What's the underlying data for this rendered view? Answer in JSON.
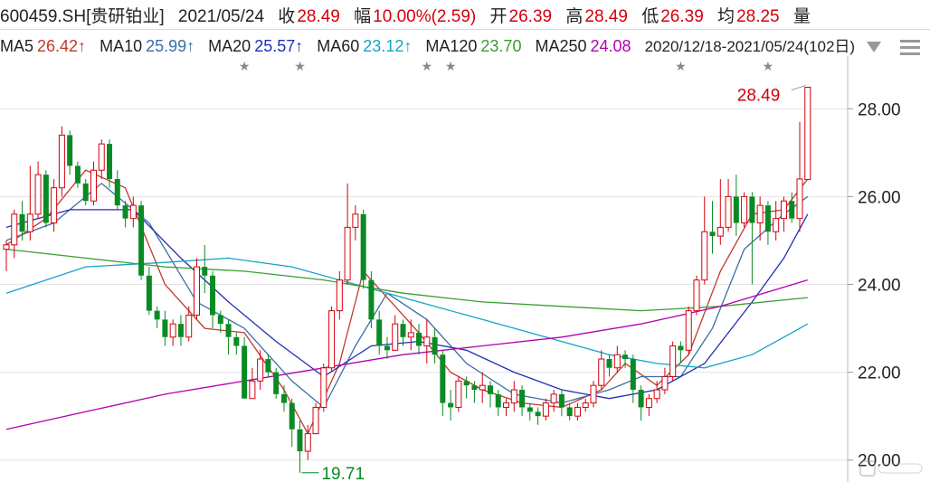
{
  "header": {
    "symbol": "600459.SH[贵研铂业]",
    "date": "2021/05/24",
    "close_label": "收",
    "close": "28.49",
    "change_label": "幅",
    "change": "10.00%(2.59)",
    "open_label": "开",
    "open": "26.39",
    "high_label": "高",
    "high": "28.49",
    "low_label": "低",
    "low": "26.39",
    "avg_label": "均",
    "avg": "28.25",
    "vol_label": "量"
  },
  "ma_bar": [
    {
      "name": "MA5",
      "value": "26.42↑",
      "color": "#c0392b"
    },
    {
      "name": "MA10",
      "value": "25.99↑",
      "color": "#3a6ea5"
    },
    {
      "name": "MA20",
      "value": "25.57↑",
      "color": "#1f2fb8"
    },
    {
      "name": "MA60",
      "value": "23.12↑",
      "color": "#14a4c4"
    },
    {
      "name": "MA120",
      "value": "23.70",
      "color": "#3a9c2f"
    },
    {
      "name": "MA250",
      "value": "24.08",
      "color": "#b100b1"
    }
  ],
  "range_text": "2020/12/18-2021/05/24(102日)",
  "chart_data": {
    "type": "candlestick",
    "ylim": [
      19.5,
      29.2
    ],
    "yticks": [
      "20.00",
      "22.00",
      "24.00",
      "26.00",
      "28.00"
    ],
    "ytick_values": [
      20,
      22,
      24,
      26,
      28
    ],
    "high_marker": {
      "label": "28.49",
      "index": 101,
      "value": 28.49
    },
    "low_marker": {
      "label": "19.71",
      "index": 37,
      "value": 19.71
    },
    "event_star_indices": [
      30,
      37,
      53,
      56,
      85,
      96
    ],
    "candles": [
      [
        24.8,
        24.9,
        24.3,
        25.0
      ],
      [
        24.9,
        25.6,
        24.6,
        25.7
      ],
      [
        25.6,
        25.2,
        25.0,
        25.9
      ],
      [
        25.2,
        25.6,
        25.0,
        26.7
      ],
      [
        25.6,
        26.5,
        25.5,
        26.8
      ],
      [
        26.5,
        25.4,
        25.3,
        26.6
      ],
      [
        25.4,
        26.2,
        25.2,
        26.4
      ],
      [
        26.2,
        27.4,
        26.0,
        27.6
      ],
      [
        27.4,
        26.7,
        26.5,
        27.5
      ],
      [
        26.7,
        26.3,
        26.2,
        26.8
      ],
      [
        26.3,
        25.9,
        25.8,
        26.4
      ],
      [
        25.9,
        26.6,
        25.8,
        26.8
      ],
      [
        26.6,
        27.2,
        26.4,
        27.3
      ],
      [
        27.2,
        26.4,
        26.2,
        27.3
      ],
      [
        26.4,
        25.8,
        25.7,
        26.6
      ],
      [
        25.8,
        25.5,
        25.3,
        25.9
      ],
      [
        25.5,
        25.8,
        25.3,
        26.0
      ],
      [
        25.8,
        24.2,
        24.1,
        25.9
      ],
      [
        24.2,
        23.4,
        23.3,
        24.4
      ],
      [
        23.4,
        23.2,
        23.0,
        23.5
      ],
      [
        23.2,
        22.8,
        22.6,
        23.4
      ],
      [
        22.8,
        23.1,
        22.6,
        23.2
      ],
      [
        23.1,
        22.8,
        22.6,
        23.3
      ],
      [
        22.8,
        23.3,
        22.7,
        23.5
      ],
      [
        23.3,
        24.4,
        23.2,
        24.6
      ],
      [
        24.4,
        24.2,
        23.8,
        24.9
      ],
      [
        24.2,
        23.3,
        23.0,
        24.3
      ],
      [
        23.3,
        23.1,
        22.9,
        23.4
      ],
      [
        23.1,
        22.8,
        22.4,
        23.2
      ],
      [
        22.8,
        22.6,
        22.4,
        22.9
      ],
      [
        22.6,
        21.4,
        21.4,
        22.8
      ],
      [
        21.4,
        21.8,
        21.5,
        22.1
      ],
      [
        21.8,
        22.3,
        21.6,
        22.5
      ],
      [
        22.3,
        22.0,
        21.9,
        22.4
      ],
      [
        22.0,
        21.5,
        21.4,
        22.1
      ],
      [
        21.5,
        21.3,
        21.1,
        21.7
      ],
      [
        21.3,
        20.7,
        20.3,
        21.4
      ],
      [
        20.7,
        20.2,
        19.71,
        20.9
      ],
      [
        20.2,
        20.6,
        20.0,
        20.8
      ],
      [
        20.6,
        21.2,
        20.6,
        21.3
      ],
      [
        21.2,
        22.1,
        21.1,
        22.2
      ],
      [
        22.1,
        23.4,
        22.0,
        23.5
      ],
      [
        23.4,
        24.1,
        23.2,
        24.3
      ],
      [
        24.1,
        25.3,
        24.0,
        26.3
      ],
      [
        25.3,
        25.6,
        25.0,
        25.8
      ],
      [
        25.6,
        24.1,
        23.9,
        25.7
      ],
      [
        24.1,
        23.2,
        23.0,
        24.3
      ],
      [
        23.2,
        22.6,
        22.4,
        23.4
      ],
      [
        22.6,
        22.5,
        22.3,
        22.8
      ],
      [
        22.5,
        23.1,
        22.5,
        23.3
      ],
      [
        23.1,
        22.8,
        22.6,
        23.2
      ],
      [
        22.8,
        22.9,
        22.5,
        23.2
      ],
      [
        22.9,
        22.6,
        22.4,
        23.1
      ],
      [
        22.6,
        22.8,
        22.2,
        23.2
      ],
      [
        22.8,
        22.4,
        22.2,
        23.0
      ],
      [
        22.4,
        21.3,
        21.0,
        22.5
      ],
      [
        21.3,
        21.2,
        20.9,
        21.6
      ],
      [
        21.2,
        21.8,
        21.1,
        21.9
      ],
      [
        21.8,
        21.7,
        21.4,
        21.9
      ],
      [
        21.7,
        21.6,
        21.3,
        21.8
      ],
      [
        21.6,
        21.7,
        21.3,
        22.0
      ],
      [
        21.7,
        21.5,
        21.2,
        21.8
      ],
      [
        21.5,
        21.2,
        21.0,
        21.6
      ],
      [
        21.2,
        21.3,
        21.0,
        21.4
      ],
      [
        21.3,
        21.6,
        21.1,
        21.8
      ],
      [
        21.6,
        21.2,
        21.0,
        21.7
      ],
      [
        21.2,
        21.1,
        20.9,
        21.3
      ],
      [
        21.1,
        21.0,
        20.8,
        21.2
      ],
      [
        21.0,
        21.3,
        20.9,
        21.4
      ],
      [
        21.3,
        21.5,
        21.1,
        21.6
      ],
      [
        21.5,
        21.2,
        21.0,
        21.6
      ],
      [
        21.2,
        21.0,
        20.9,
        21.3
      ],
      [
        21.0,
        21.2,
        20.9,
        21.3
      ],
      [
        21.2,
        21.3,
        21.1,
        21.4
      ],
      [
        21.3,
        21.7,
        21.2,
        21.8
      ],
      [
        21.7,
        22.3,
        21.6,
        22.5
      ],
      [
        22.3,
        22.1,
        21.9,
        22.4
      ],
      [
        22.1,
        22.4,
        22.0,
        22.6
      ],
      [
        22.4,
        22.3,
        22.1,
        22.5
      ],
      [
        22.3,
        21.6,
        21.3,
        22.4
      ],
      [
        21.6,
        21.2,
        20.9,
        21.7
      ],
      [
        21.2,
        21.4,
        21.0,
        21.5
      ],
      [
        21.4,
        21.6,
        21.3,
        21.8
      ],
      [
        21.6,
        21.9,
        21.5,
        22.1
      ],
      [
        21.9,
        22.6,
        21.8,
        22.7
      ],
      [
        22.6,
        22.5,
        22.2,
        22.7
      ],
      [
        22.5,
        23.4,
        22.4,
        23.5
      ],
      [
        23.4,
        24.1,
        23.3,
        24.2
      ],
      [
        24.1,
        25.2,
        24.0,
        26.0
      ],
      [
        25.2,
        25.1,
        24.7,
        25.9
      ],
      [
        25.1,
        25.3,
        24.9,
        26.4
      ],
      [
        25.3,
        26.0,
        25.2,
        26.4
      ],
      [
        26.0,
        25.4,
        25.1,
        26.5
      ],
      [
        25.4,
        26.0,
        25.3,
        26.1
      ],
      [
        26.0,
        25.4,
        24.0,
        26.1
      ],
      [
        25.4,
        25.8,
        25.0,
        26.0
      ],
      [
        25.8,
        25.2,
        24.9,
        25.9
      ],
      [
        25.2,
        25.5,
        25.0,
        25.9
      ],
      [
        25.5,
        25.9,
        25.2,
        26.0
      ],
      [
        25.9,
        25.5,
        25.4,
        26.1
      ],
      [
        25.5,
        26.4,
        25.2,
        27.7
      ],
      [
        26.39,
        28.49,
        26.39,
        28.49
      ]
    ],
    "ma_series": [
      {
        "name": "MA5",
        "color": "#c0392b"
      },
      {
        "name": "MA10",
        "color": "#3a6ea5"
      },
      {
        "name": "MA20",
        "color": "#1f2fb8"
      },
      {
        "name": "MA60",
        "color": "#14a4c4"
      },
      {
        "name": "MA120",
        "color": "#3a9c2f"
      },
      {
        "name": "MA250",
        "color": "#b100b1"
      }
    ],
    "ma_points": {
      "MA5": [
        [
          0,
          24.9
        ],
        [
          5,
          25.5
        ],
        [
          10,
          26.6
        ],
        [
          15,
          26.2
        ],
        [
          20,
          24.0
        ],
        [
          25,
          23.0
        ],
        [
          30,
          22.9
        ],
        [
          35,
          21.6
        ],
        [
          38,
          20.6
        ],
        [
          42,
          22.2
        ],
        [
          45,
          24.3
        ],
        [
          48,
          23.7
        ],
        [
          52,
          22.9
        ],
        [
          56,
          22.0
        ],
        [
          60,
          21.6
        ],
        [
          65,
          21.3
        ],
        [
          70,
          21.2
        ],
        [
          75,
          21.6
        ],
        [
          78,
          22.2
        ],
        [
          82,
          21.7
        ],
        [
          86,
          22.4
        ],
        [
          90,
          24.3
        ],
        [
          94,
          25.6
        ],
        [
          98,
          25.7
        ],
        [
          101,
          26.4
        ]
      ],
      "MA10": [
        [
          0,
          25.0
        ],
        [
          6,
          25.4
        ],
        [
          12,
          26.3
        ],
        [
          18,
          25.4
        ],
        [
          24,
          23.6
        ],
        [
          30,
          23.0
        ],
        [
          36,
          21.8
        ],
        [
          40,
          21.2
        ],
        [
          44,
          22.6
        ],
        [
          48,
          23.8
        ],
        [
          53,
          23.2
        ],
        [
          58,
          22.2
        ],
        [
          64,
          21.5
        ],
        [
          70,
          21.3
        ],
        [
          76,
          21.6
        ],
        [
          80,
          21.9
        ],
        [
          85,
          21.9
        ],
        [
          89,
          23.0
        ],
        [
          93,
          24.8
        ],
        [
          98,
          25.6
        ],
        [
          101,
          26.0
        ]
      ],
      "MA20": [
        [
          0,
          25.3
        ],
        [
          8,
          25.7
        ],
        [
          16,
          25.7
        ],
        [
          22,
          24.6
        ],
        [
          28,
          23.6
        ],
        [
          34,
          22.7
        ],
        [
          40,
          21.9
        ],
        [
          46,
          22.6
        ],
        [
          52,
          22.7
        ],
        [
          58,
          22.5
        ],
        [
          64,
          22.0
        ],
        [
          70,
          21.6
        ],
        [
          76,
          21.4
        ],
        [
          82,
          21.6
        ],
        [
          88,
          22.2
        ],
        [
          94,
          23.6
        ],
        [
          98,
          24.6
        ],
        [
          101,
          25.6
        ]
      ],
      "MA60": [
        [
          0,
          23.8
        ],
        [
          10,
          24.4
        ],
        [
          20,
          24.5
        ],
        [
          28,
          24.6
        ],
        [
          36,
          24.4
        ],
        [
          44,
          24.0
        ],
        [
          52,
          23.6
        ],
        [
          60,
          23.2
        ],
        [
          68,
          22.8
        ],
        [
          76,
          22.4
        ],
        [
          82,
          22.2
        ],
        [
          88,
          22.1
        ],
        [
          94,
          22.4
        ],
        [
          98,
          22.8
        ],
        [
          101,
          23.1
        ]
      ],
      "MA120": [
        [
          0,
          24.8
        ],
        [
          10,
          24.6
        ],
        [
          20,
          24.4
        ],
        [
          30,
          24.3
        ],
        [
          40,
          24.1
        ],
        [
          50,
          23.8
        ],
        [
          60,
          23.6
        ],
        [
          70,
          23.5
        ],
        [
          80,
          23.4
        ],
        [
          90,
          23.5
        ],
        [
          101,
          23.7
        ]
      ],
      "MA250": [
        [
          0,
          20.7
        ],
        [
          10,
          21.1
        ],
        [
          20,
          21.5
        ],
        [
          30,
          21.8
        ],
        [
          40,
          22.1
        ],
        [
          50,
          22.4
        ],
        [
          60,
          22.6
        ],
        [
          70,
          22.8
        ],
        [
          80,
          23.1
        ],
        [
          90,
          23.5
        ],
        [
          101,
          24.1
        ]
      ]
    }
  }
}
